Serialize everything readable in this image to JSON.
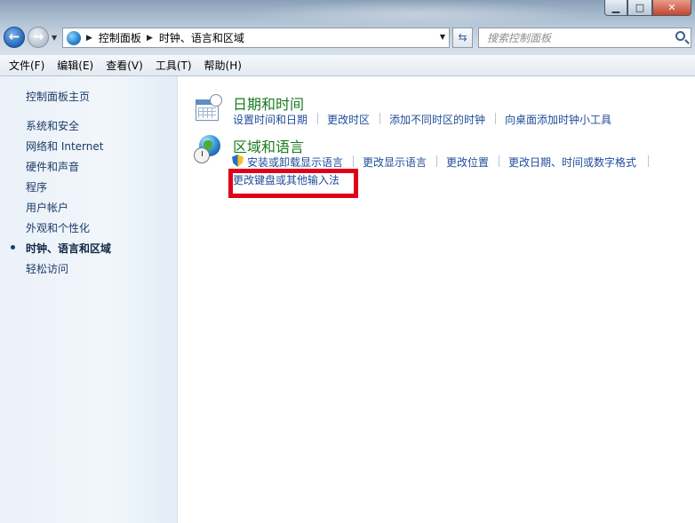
{
  "window": {
    "minimize": "▁",
    "maximize": "□",
    "close": "✕"
  },
  "nav": {
    "breadcrumb": [
      "控制面板",
      "时钟、语言和区域"
    ],
    "search_placeholder": "搜索控制面板"
  },
  "menu": [
    "文件(F)",
    "编辑(E)",
    "查看(V)",
    "工具(T)",
    "帮助(H)"
  ],
  "sidebar": {
    "items": [
      {
        "label": "控制面板主页",
        "active": false
      },
      {
        "label": "系统和安全",
        "active": false
      },
      {
        "label": "网络和 Internet",
        "active": false
      },
      {
        "label": "硬件和声音",
        "active": false
      },
      {
        "label": "程序",
        "active": false
      },
      {
        "label": "用户帐户",
        "active": false
      },
      {
        "label": "外观和个性化",
        "active": false
      },
      {
        "label": "时钟、语言和区域",
        "active": true
      },
      {
        "label": "轻松访问",
        "active": false
      }
    ]
  },
  "sections": [
    {
      "title": "日期和时间",
      "icon": "calendar-clock-icon",
      "links": [
        "设置时间和日期",
        "更改时区",
        "添加不同时区的时钟",
        "向桌面添加时钟小工具"
      ]
    },
    {
      "title": "区域和语言",
      "icon": "globe-clock-icon",
      "links": [
        "安装或卸载显示语言",
        "更改显示语言",
        "更改位置",
        "更改日期、时间或数字格式",
        "更改键盘或其他输入法"
      ]
    }
  ],
  "colors": {
    "section_title": "#1a7a1e",
    "link": "#1f4c9a",
    "highlight": "#e00018"
  }
}
